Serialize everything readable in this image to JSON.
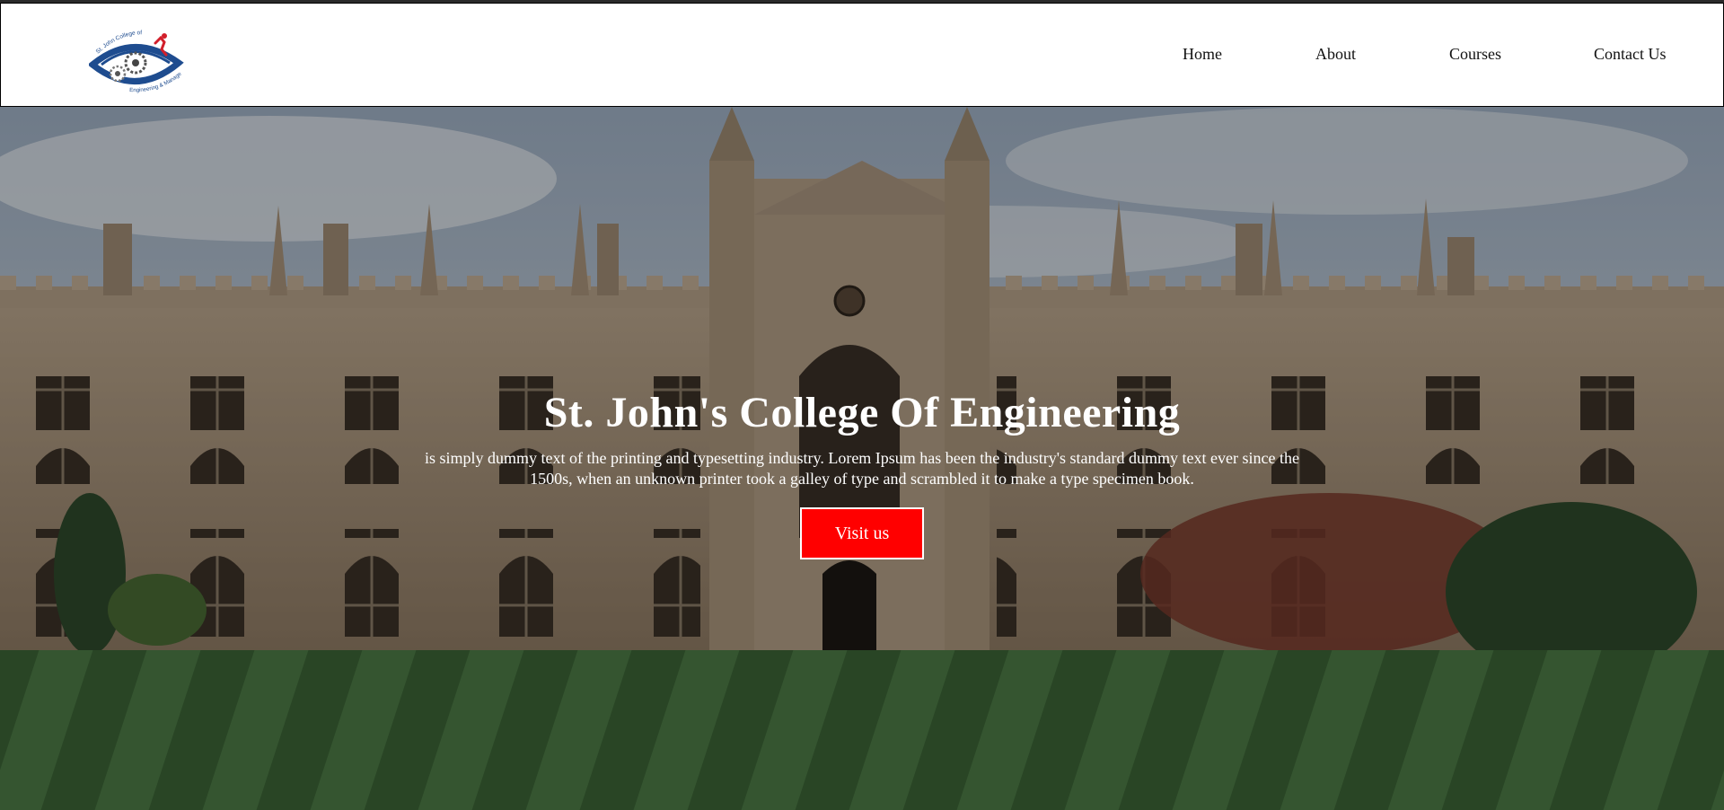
{
  "brand": {
    "logo_text_top": "St. John College of",
    "logo_text_bottom": "Engineering & Management",
    "colors": {
      "logo_blue": "#1e4c8f",
      "logo_red": "#d21f2b"
    }
  },
  "nav": {
    "items": [
      {
        "label": "Home"
      },
      {
        "label": "About"
      },
      {
        "label": "Courses"
      },
      {
        "label": "Contact Us"
      }
    ]
  },
  "hero": {
    "title": "St. John's College Of Engineering",
    "description": "is simply dummy text of the printing and typesetting industry. Lorem Ipsum has been the industry's standard dummy text ever since the 1500s, when an unknown printer took a galley of type and scrambled it to make a type specimen book.",
    "button_label": "Visit us",
    "colors": {
      "button_bg": "#ff0000",
      "text": "#ffffff"
    }
  }
}
